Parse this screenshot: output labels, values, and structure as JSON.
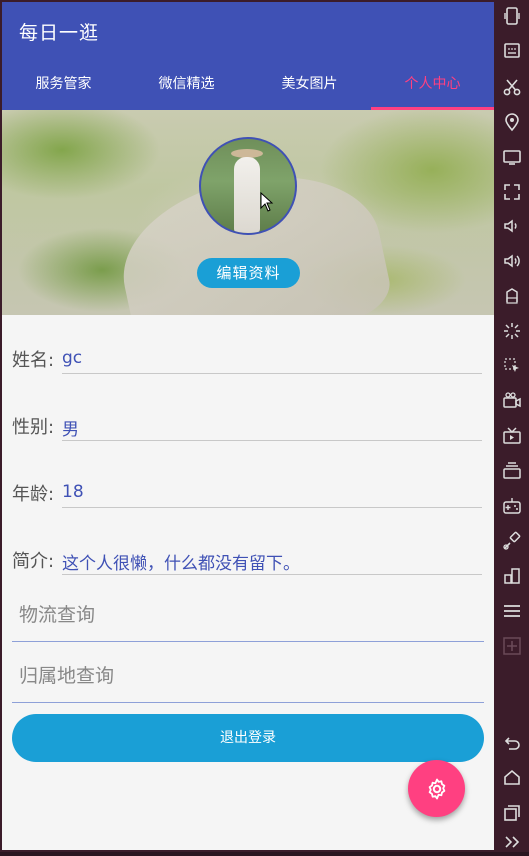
{
  "app": {
    "title": "每日一逛"
  },
  "tabs": [
    {
      "label": "服务管家"
    },
    {
      "label": "微信精选"
    },
    {
      "label": "美女图片"
    },
    {
      "label": "个人中心"
    }
  ],
  "profile": {
    "edit_button": "编辑资料",
    "fields": [
      {
        "label": "姓名:",
        "value": "gc"
      },
      {
        "label": "性别:",
        "value": "男"
      },
      {
        "label": "年龄:",
        "value": "18"
      },
      {
        "label": "简介:",
        "value": "这个人很懒，什么都没有留下。"
      }
    ]
  },
  "queries": {
    "logistics_placeholder": "物流查询",
    "location_placeholder": "归属地查询"
  },
  "logout_button": "退出登录",
  "fab_icon": "settings-icon",
  "emulator_sidebar_icons": [
    "phone-icon",
    "keyboard-icon",
    "scissors-icon",
    "location-icon",
    "screen-icon",
    "fullscreen-icon",
    "volume-down-icon",
    "volume-up-icon",
    "rotate-3d-icon",
    "shake-icon",
    "mouse-icon",
    "camera-icon",
    "tv-icon",
    "storage-icon",
    "gamepad-icon",
    "link-icon",
    "layout-icon",
    "menu-icon",
    "add-icon",
    "back-icon",
    "home-icon",
    "recents-icon",
    "more-icon"
  ],
  "colors": {
    "primary": "#3f51b5",
    "accent": "#ff4081",
    "button": "#1a9fd6"
  }
}
